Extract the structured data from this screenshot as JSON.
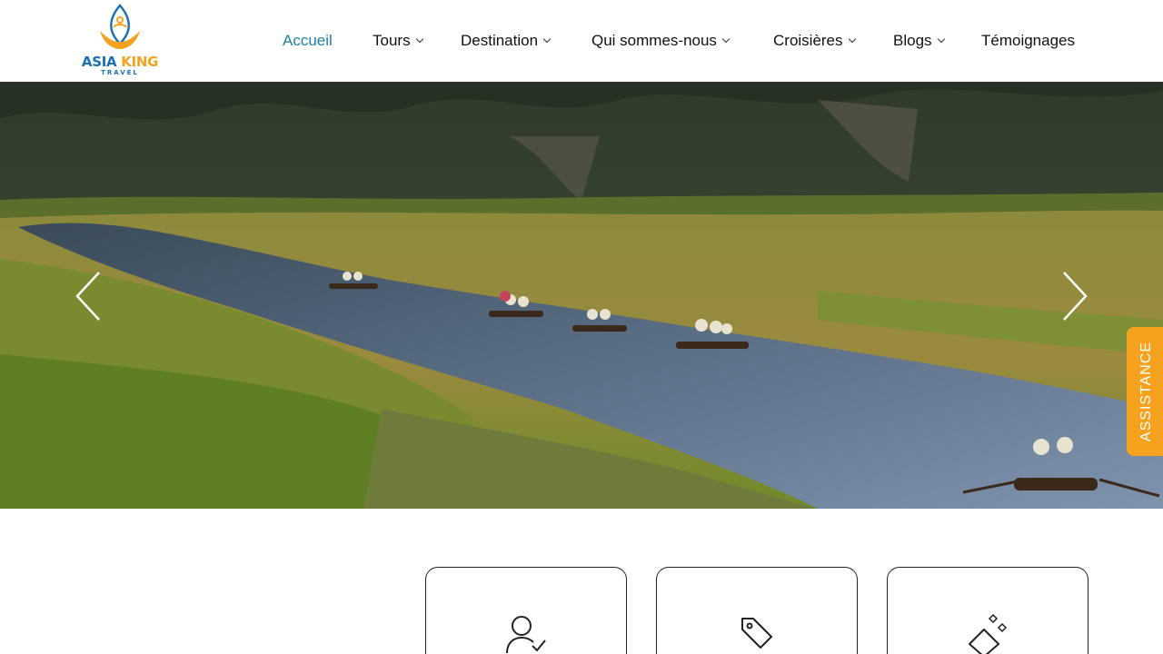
{
  "brand": {
    "name_part1": "ASIA ",
    "name_part2": "KING",
    "subtitle": "TRAVEL",
    "colors": {
      "blue": "#1a6fb5",
      "orange": "#f3a21f"
    }
  },
  "nav": {
    "items": [
      {
        "label": "Accueil",
        "active": true,
        "dropdown": false
      },
      {
        "label": "Tours",
        "active": false,
        "dropdown": true
      },
      {
        "label": "Destination",
        "active": false,
        "dropdown": true
      },
      {
        "label": "Qui sommes-nous",
        "active": false,
        "dropdown": true
      },
      {
        "label": "Croisières",
        "active": false,
        "dropdown": true
      },
      {
        "label": "Blogs",
        "active": false,
        "dropdown": true
      },
      {
        "label": "Témoignages",
        "active": false,
        "dropdown": false
      }
    ],
    "active_color": "#1f7fa8"
  },
  "hero": {
    "prev_icon": "chevron-left-icon",
    "next_icon": "chevron-right-icon"
  },
  "assistance": {
    "label": "ASSISTANCE",
    "color": "#f6a21e"
  },
  "features": [
    {
      "icon": "user-check-icon"
    },
    {
      "icon": "price-tag-icon"
    },
    {
      "icon": "diamond-sparkle-icon"
    }
  ]
}
